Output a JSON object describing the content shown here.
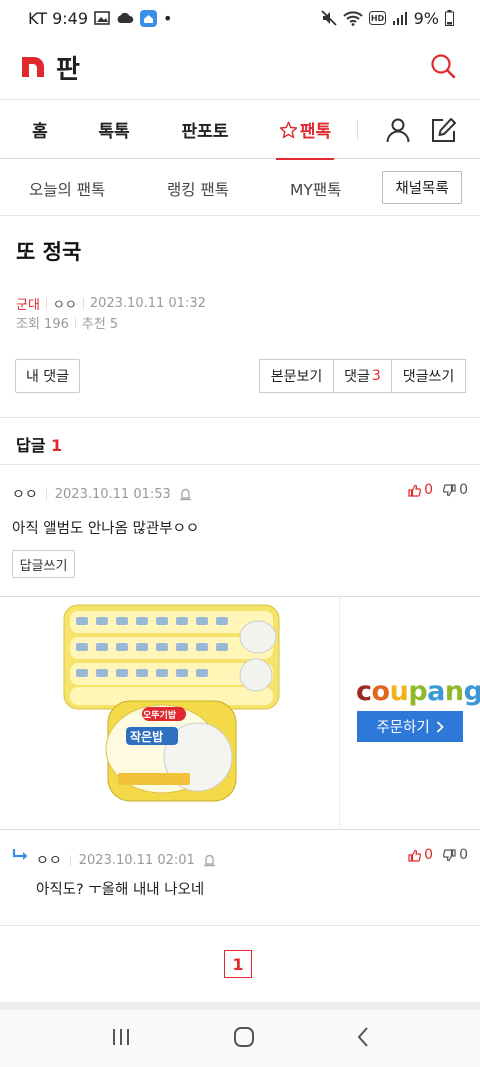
{
  "status_bar": {
    "carrier_time": "KT 9:49",
    "dot": "•",
    "battery": "9%"
  },
  "header": {
    "title": "판"
  },
  "main_nav": {
    "items": [
      "홈",
      "톡톡",
      "판포토",
      "팬톡"
    ]
  },
  "sub_nav": {
    "items": [
      "오늘의 팬톡",
      "랭킹 팬톡",
      "MY팬톡"
    ],
    "channel_button": "채널목록"
  },
  "post": {
    "title": "또 정국",
    "category": "군대",
    "author": "ㅇㅇ",
    "date": "2023.10.11 01:32",
    "views": "조회 196",
    "recommends": "추천 5"
  },
  "post_actions": {
    "my_comment": "내 댓글",
    "view_body": "본문보기",
    "comments_label": "댓글",
    "comments_count": "3",
    "write_comment": "댓글쓰기"
  },
  "replies": {
    "label": "답글",
    "count": "1"
  },
  "comments": [
    {
      "nick": "ㅇㅇ",
      "date": "2023.10.11 01:53",
      "text": "아직 앨범도 안나옴 많관부ㅇㅇ",
      "up": "0",
      "down": "0",
      "reply_button": "답글쓰기"
    },
    {
      "nick": "ㅇㅇ",
      "date": "2023.10.11 02:01",
      "text": "아직도? ㅜ올해 내내 나오네",
      "up": "0",
      "down": "0"
    }
  ],
  "ad": {
    "brand": "coupang",
    "cta": "주문하기",
    "product_name": "작은밥",
    "product_brand": "오뚜기밥",
    "brand_colors": [
      "#9b2a1f",
      "#e1651e",
      "#f3b21c",
      "#8fb82b",
      "#3a98d6"
    ]
  },
  "pagination": {
    "current": "1"
  },
  "colors": {
    "accent": "#e0292e",
    "cta_blue": "#2e78d9"
  }
}
